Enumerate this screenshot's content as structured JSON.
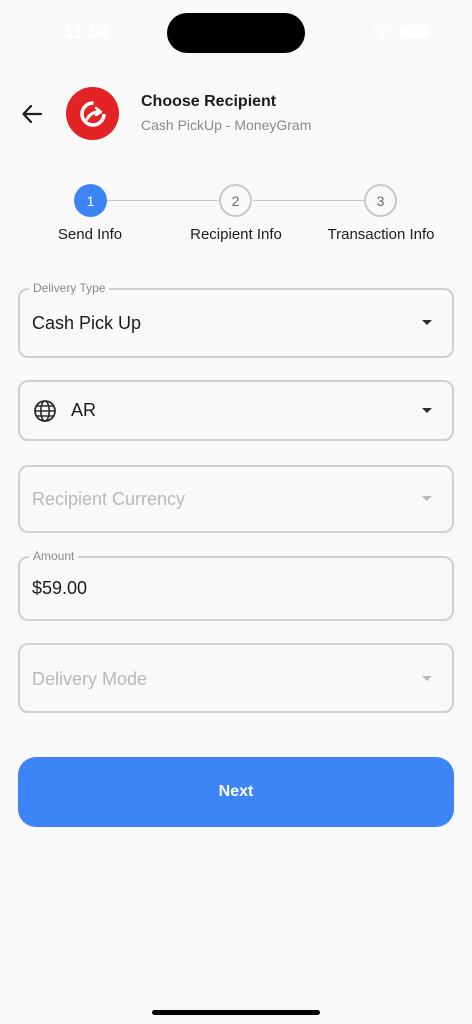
{
  "status_bar": {
    "time": "11:58"
  },
  "header": {
    "title": "Choose Recipient",
    "subtitle": "Cash PickUp - MoneyGram",
    "logo_color": "#e42327",
    "back_icon": "arrow-left-icon"
  },
  "stepper": {
    "steps": [
      {
        "number": "1",
        "label": "Send Info",
        "state": "active"
      },
      {
        "number": "2",
        "label": "Recipient Info",
        "state": "inactive"
      },
      {
        "number": "3",
        "label": "Transaction Info",
        "state": "inactive"
      }
    ]
  },
  "form": {
    "delivery_type": {
      "label": "Delivery Type",
      "value": "Cash Pick Up"
    },
    "country": {
      "value": "AR",
      "icon": "globe-icon"
    },
    "recipient_currency": {
      "placeholder": "Recipient Currency"
    },
    "amount": {
      "label": "Amount",
      "value": "$59.00"
    },
    "delivery_mode": {
      "placeholder": "Delivery Mode"
    }
  },
  "actions": {
    "next_label": "Next"
  },
  "colors": {
    "accent": "#3d85f7",
    "brand_red": "#e42327"
  }
}
